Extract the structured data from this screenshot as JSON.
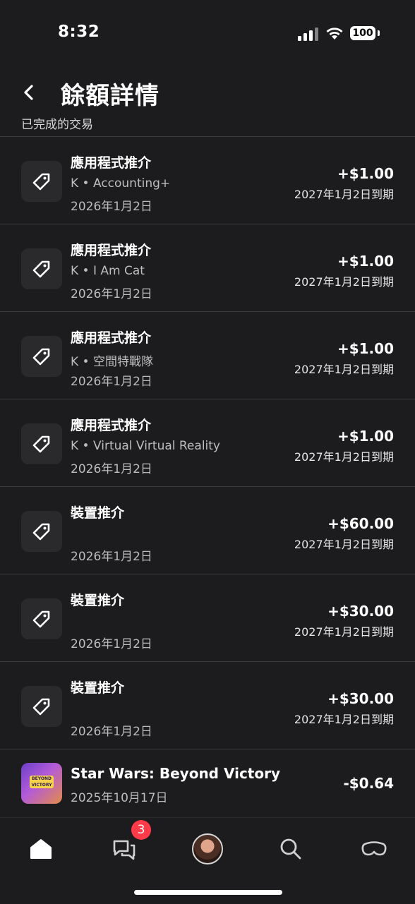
{
  "status_bar": {
    "time": "8:32",
    "battery": "100"
  },
  "header": {
    "title": "餘額詳情"
  },
  "section_label": "已完成的交易",
  "transactions": [
    {
      "title": "應用程式推介",
      "subtitle": "K • Accounting+",
      "date": "2026年1月2日",
      "amount": "+$1.00",
      "expiry": "2027年1月2日到期"
    },
    {
      "title": "應用程式推介",
      "subtitle": "K • I Am Cat",
      "date": "2026年1月2日",
      "amount": "+$1.00",
      "expiry": "2027年1月2日到期"
    },
    {
      "title": "應用程式推介",
      "subtitle": "K • 空間特戰隊",
      "date": "2026年1月2日",
      "amount": "+$1.00",
      "expiry": "2027年1月2日到期"
    },
    {
      "title": "應用程式推介",
      "subtitle": "K • Virtual Virtual Reality",
      "date": "2026年1月2日",
      "amount": "+$1.00",
      "expiry": "2027年1月2日到期"
    },
    {
      "title": "裝置推介",
      "subtitle": "",
      "date": "2026年1月2日",
      "amount": "+$60.00",
      "expiry": "2027年1月2日到期"
    },
    {
      "title": "裝置推介",
      "subtitle": "",
      "date": "2026年1月2日",
      "amount": "+$30.00",
      "expiry": "2027年1月2日到期"
    },
    {
      "title": "裝置推介",
      "subtitle": "",
      "date": "2026年1月2日",
      "amount": "+$30.00",
      "expiry": "2027年1月2日到期"
    }
  ],
  "purchase": {
    "title": "Star Wars: Beyond Victory",
    "date": "2025年10月17日",
    "amount": "-$0.64",
    "thumb_text": "BEYOND VICTORY"
  },
  "nav": {
    "chat_badge": "3",
    "icons": [
      "home-icon",
      "chat-icon",
      "avatar",
      "search-icon",
      "vr-headset-icon"
    ]
  },
  "colors": {
    "background": "#1c1c1e",
    "divider": "#3a3a3c",
    "badge": "#ff3b4a"
  }
}
